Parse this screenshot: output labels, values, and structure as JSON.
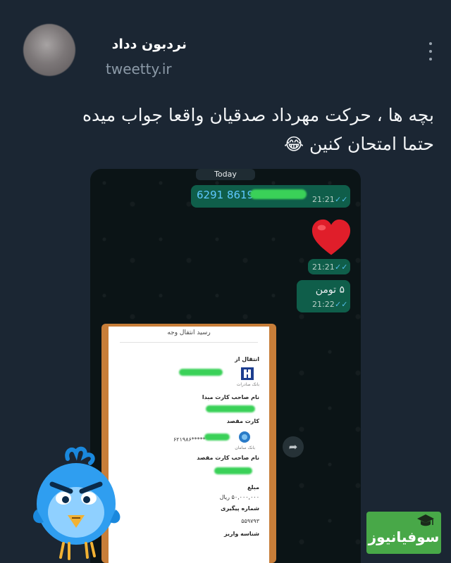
{
  "tweet": {
    "author_name": "نردبون دداد",
    "handle": "tweetty.ir",
    "text_line1": "بچه ها ، حرکت مهرداد صدقیان واقعا جواب میده",
    "text_line2": "حتما امتحان کنین",
    "emoji": "😂"
  },
  "chat": {
    "date_label": "Today",
    "msg1_number": "6291 8619",
    "msg1_time": "21:21",
    "msg2_time": "21:21",
    "msg3_text": "۵ تومن",
    "msg3_time": "21:22",
    "ticks": "✓✓"
  },
  "receipt": {
    "title": "رسید انتقال وجه",
    "from_label": "انتقال از",
    "source_owner_label": "نام صاحب کارت مبدا",
    "dest_card_label": "کارت مقصد",
    "dest_card_value": "۶۲۱۹۸۶*****",
    "dest_owner_label": "نام صاحب کارت مقصد",
    "amount_label": "مبلغ",
    "amount_value": "۵۰,۰۰۰,۰۰۰ ریال",
    "tracking_label": "شماره پیگیری",
    "tracking_value": "۵۵۹۷۹۳",
    "deposit_id_label": "شناسه واریز",
    "bank1_name": "بانک صادرات",
    "bank2_name": "بانک سامان"
  },
  "watermark": {
    "logo_text": "سوفیانیوز"
  },
  "colors": {
    "background": "#1b2633",
    "bubble": "#0f5e4a",
    "redaction": "#3ad158",
    "logo": "#48a848"
  }
}
